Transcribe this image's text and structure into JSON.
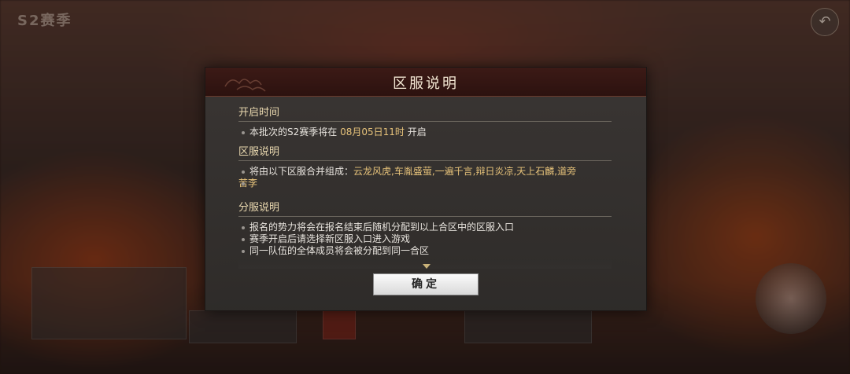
{
  "background": {
    "title": "S2赛季",
    "back_icon": "back-arrow-icon"
  },
  "dialog": {
    "title": "区服说明",
    "sections": [
      {
        "heading": "开启时间",
        "line_prefix": "本批次的S2赛季将在 ",
        "line_highlight": "08月05日11时",
        "line_suffix": " 开启"
      },
      {
        "heading": "区服说明",
        "line_prefix": "将由以下区服合并组成：",
        "line_highlight_1": "云龙风虎,车胤盛萤,一遍千言,辩日炎凉,天上石麟,道旁",
        "line_highlight_2": "苦李"
      },
      {
        "heading": "分服说明",
        "lines": [
          "报名的势力将会在报名结束后随机分配到以上合区中的区服入口",
          "赛季开启后请选择新区服入口进入游戏",
          "同一队伍的全体成员将会被分配到同一合区"
        ]
      }
    ],
    "confirm_label": "确定"
  },
  "colors": {
    "highlight": "#e6c27a",
    "heading": "#ead9b0",
    "header_bg": "#3c1a16"
  }
}
